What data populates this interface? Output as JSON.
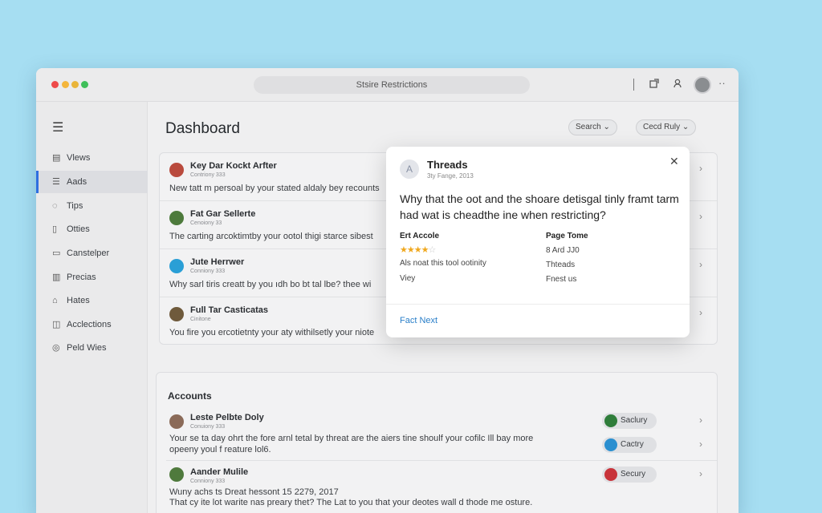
{
  "window": {
    "address_title": "Stsire Restrictions"
  },
  "toolbar": {
    "icons": [
      "share-icon",
      "user-icon",
      "avatar",
      "more-icon"
    ],
    "more": "··"
  },
  "sidebar": {
    "menu_icon": "☰",
    "items": [
      {
        "label": "Vlews",
        "icon": "▤"
      },
      {
        "label": "Aads",
        "icon": "☰"
      },
      {
        "label": "Tips",
        "icon": "◌"
      },
      {
        "label": "Otties",
        "icon": "▯"
      },
      {
        "label": "Canstelper",
        "icon": "▭"
      },
      {
        "label": "Precias",
        "icon": "▥"
      },
      {
        "label": "Hates",
        "icon": "⌂"
      },
      {
        "label": "Acclections",
        "icon": "◫"
      },
      {
        "label": "Peld Wies",
        "icon": "◎"
      }
    ]
  },
  "main": {
    "title": "Dashboard",
    "search_chip": "Search ⌄",
    "filter_chip": "Cecd Ruly ⌄"
  },
  "threads": [
    {
      "name": "Key Dar Kockt Arfter",
      "meta": "Contriony 333",
      "text": "New tatt m persoal by your stated aldaly bey recounts",
      "avatar_color": "#b94a3d"
    },
    {
      "name": "Fat Gar Sellerte",
      "meta": "Cenoiony 33",
      "text": "The carting arcoktimtby your ootol thigi starce sibest",
      "avatar_color": "#4d7a3c"
    },
    {
      "name": "Jute Herrwer",
      "meta": "Conniony 333",
      "text": "Why sarl tiris creatt by you ıdh bo bt tal lbe? thee wi",
      "avatar_color": "#2a9fd6"
    },
    {
      "name": "Full Tar Casticatas",
      "meta": "Cinitone",
      "text": "You fire you ercotietnty your aty withilsetly your niote",
      "avatar_color": "#6f5a3c"
    }
  ],
  "accounts": {
    "title": "Accounts",
    "items": [
      {
        "name": "Leste Pelbte Doly",
        "meta": "Conuiony 333",
        "text1": "Your se ta day ohrt the fore arnl tetal by threat are the aiers tine shoulf your cofilc Ill bay more",
        "text2": "opeeny youl f reature lol6.",
        "pill1": "Saclury",
        "pill1_color": "#2f7d3a",
        "pill2": "Cactry",
        "pill2_color": "#2a8fd0",
        "avatar_color": "#8a6a58"
      },
      {
        "name": "Aander Mulile",
        "meta": "Conniony 333",
        "text1": "Wuny achs ts Dreat hessont 15 2279, 2017",
        "text2": "That cy ite lot warite nas preary thet? The Lat to you that your deotes wall d thode me osture.",
        "pill1": "Secury",
        "pill1_color": "#c8333a",
        "avatar_color": "#4f7a3d"
      }
    ]
  },
  "modal": {
    "avatar_letter": "A",
    "title": "Threads",
    "subtitle": "3ty Fange, 2013",
    "close": "✕",
    "question": "Why that the oot and the shoare detisgal tinly framt tarm had wat is cheadthe ine when restricting?",
    "col1": {
      "heading": "Ert Accole",
      "rating": 4,
      "rating_max": 5,
      "line2": "Als noat this tool ootinity",
      "line3": "Viey"
    },
    "col2": {
      "heading": "Page Tome",
      "line1": "8 Ard JJ0",
      "line2": "Thteads",
      "line3": "Fnest us"
    },
    "next": "Fact Next"
  }
}
